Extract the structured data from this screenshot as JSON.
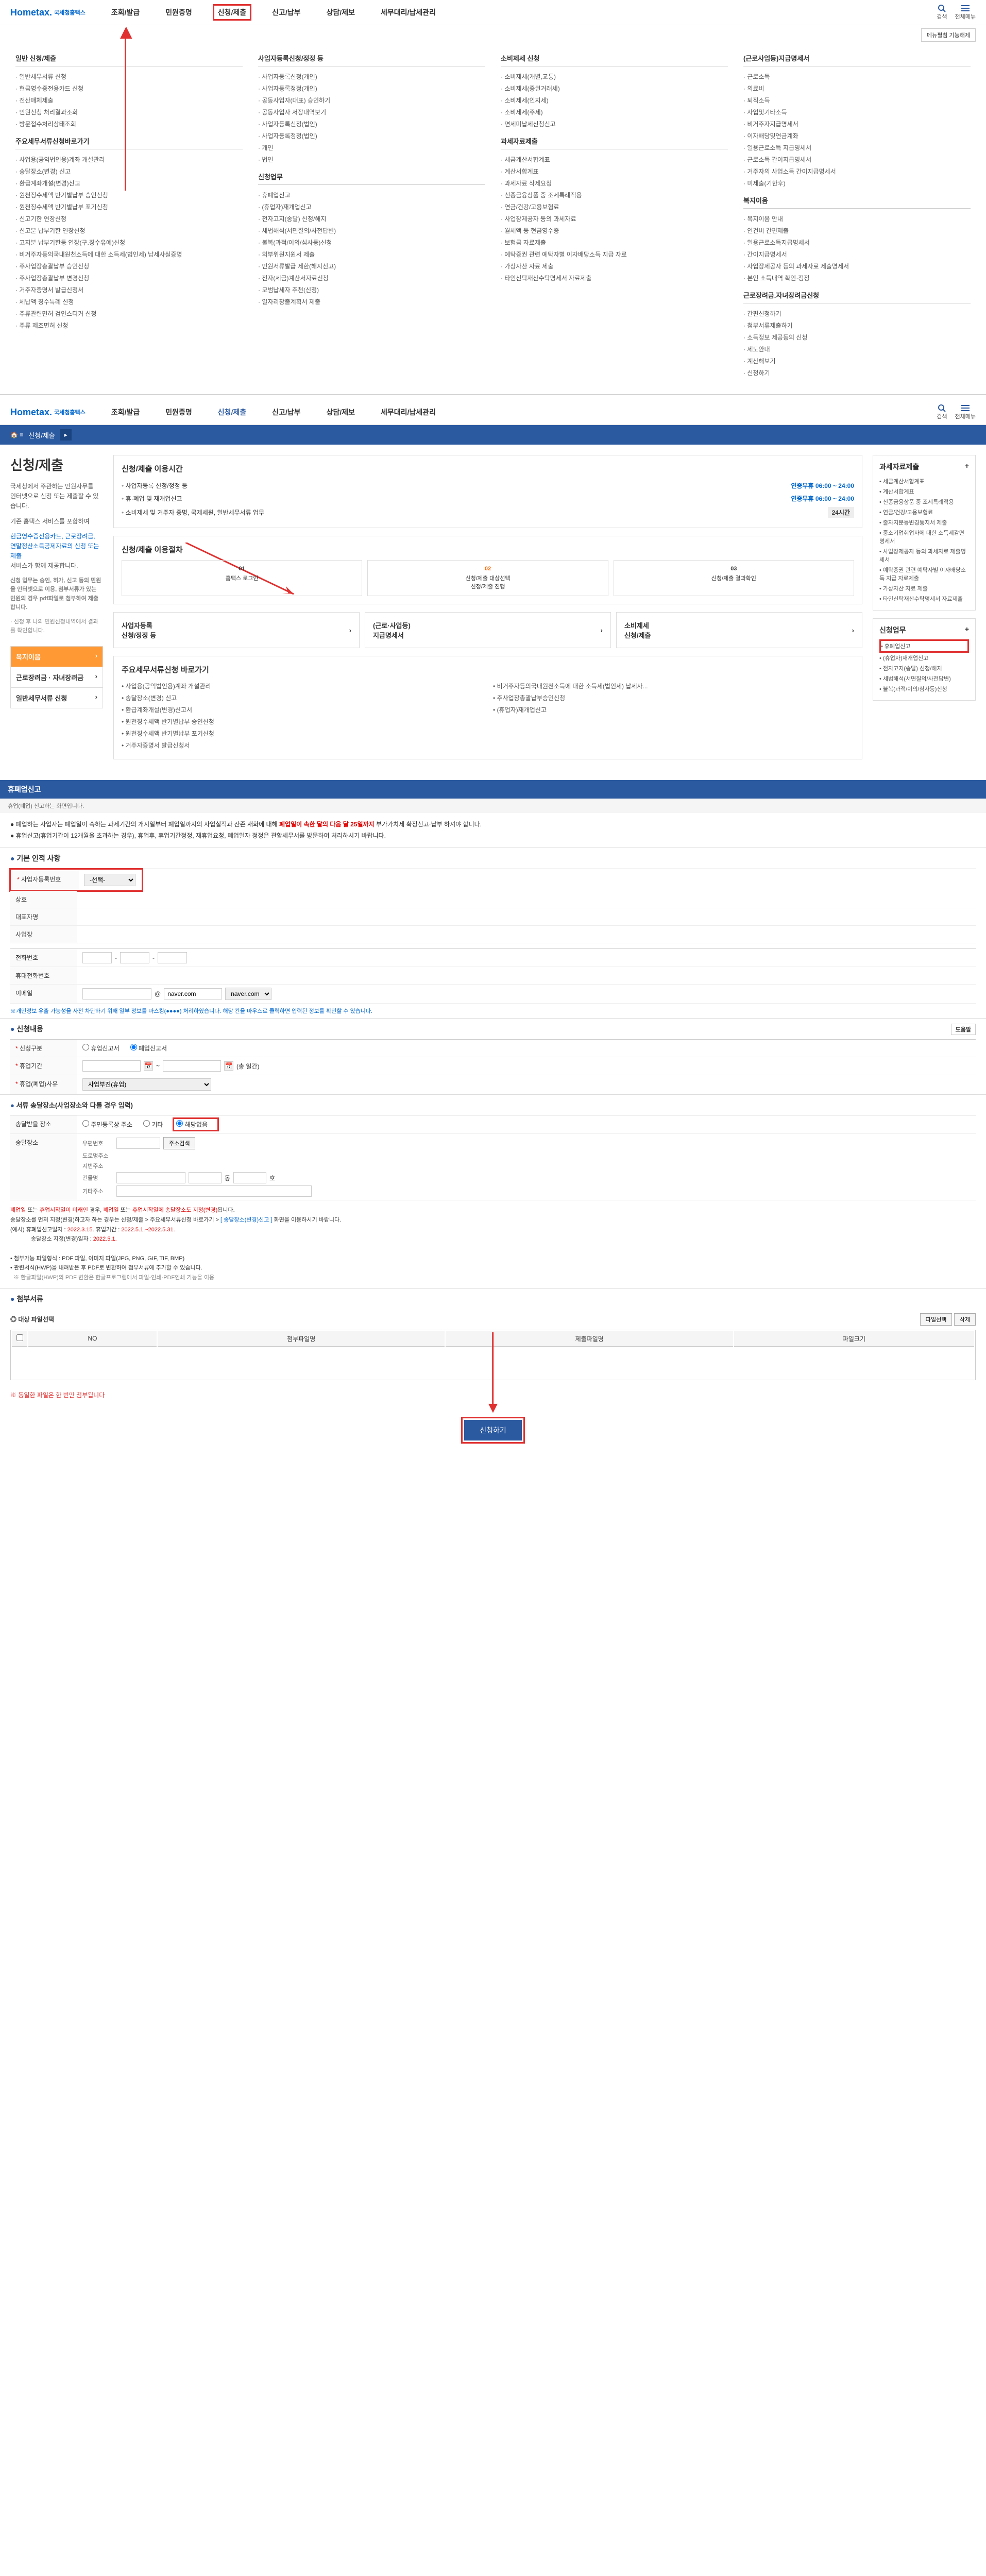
{
  "logo": {
    "main": "Hometax.",
    "sub": "국세청홈택스"
  },
  "nav": [
    "조회/발급",
    "민원증명",
    "신청/제출",
    "신고/납부",
    "상담/제보",
    "세무대리/납세관리"
  ],
  "rightIcons": {
    "search": "검색",
    "all": "전체메뉴"
  },
  "menuFunc": "메뉴펼침 기능해제",
  "mega": {
    "c1t1": "일반 신청/제출",
    "c1l1": [
      "일반세무서류 신청",
      "현금영수증전용카드 신청",
      "전산매체제출",
      "민원신청 처리결과조회",
      "방문접수처리상태조회"
    ],
    "c1t2": "주요세무서류신청바로가기",
    "c1l2": [
      "사업용(공익법인용)계좌 개설관리",
      "송달장소(변경) 신고",
      "환급계좌개설(변경)신고",
      "원천징수세액 반기별납부 승인신청",
      "원천징수세액 반기별납부 포기신청",
      "신고기한 연장신청",
      "신고분 납부기한 연장신청",
      "고지분 납부기한등 연장(구.징수유예)신청",
      "비거주자등의국내원천소득에 대한 소득세(법인세) 납세사실증명",
      "주사업장총괄납부 승인신청",
      "주사업장총괄납부 변경신청",
      "거주자증명서 발급신청서",
      "체납액 징수특례 신청",
      "주류관련면허 검인스티커 신청",
      "주류 제조면허 신청"
    ],
    "c2t1": "사업자등록신청/정정 등",
    "c2l1": [
      "사업자등록신청(개인)",
      "사업자등록정정(개인)",
      "공동사업자(대표) 승인하기",
      "공동사업자 저장내역보기",
      "사업자등록신청(법인)",
      "사업자등록정정(법인)",
      "개인",
      "법인"
    ],
    "c2t2": "신청업무",
    "c2l2": [
      "휴폐업신고",
      "(휴업자)재개업신고",
      "전자고지(송달) 신청/해지",
      "세법해석(서면질의/사전답변)",
      "불복(과적/이의/심사등)신청",
      "외부위원지원서 제출",
      "민원서류발급 제한(해지신고)",
      "전자(세금)계산서자료신청",
      "모범납세자 추천(신청)",
      "일자리창출계획서 제출"
    ],
    "c3t1": "소비제세 신청",
    "c3l1": [
      "소비제세(개별,교통)",
      "소비제세(증권거래세)",
      "소비제세(인지세)",
      "소비제세(주세)",
      "면세미납세신청신고"
    ],
    "c3t2": "과세자료제출",
    "c3l2": [
      "세금계산서합계표",
      "계산서합계표",
      "과세자료 삭제요청",
      "신종금융상품 중 조세특례적용",
      "연금/건강/고용보험료",
      "사업장제공자 등의 과세자료",
      "월세액 등 현금영수증",
      "보험금 자료제출",
      "예탁증권 관련 예탁자별 이자배당소득 지급 자료",
      "가상자산 자료 제출",
      "타인신탁재산수탁명세서 자료제출"
    ],
    "c4t1": "(근로사업등)지급명세서",
    "c4l1": [
      "근로소득",
      "의료비",
      "퇴직소득",
      "사업및기타소득",
      "비거주자지급명세서",
      "이자배당및연금계좌",
      "일용근로소득 지급명세서",
      "근로소득 간이지급명세서",
      "거주자의 사업소득 간이지급명세서",
      "미제출(기한후)"
    ],
    "c4t2": "복지이음",
    "c4l2": [
      "복지이음 안내",
      "인건비 간편제출",
      "일용근로소득지급명세서",
      "간이지급명세서",
      "사업장제공자 등의 과세자료 제출명세서",
      "본인 소득내역 확인·정정"
    ],
    "c4t3": "근로장려금.자녀장려금신청",
    "c4l3": [
      "간편신청하기",
      "첨부서류제출하기",
      "소득정보 제공동의 신청",
      "제도안내",
      "계산해보기",
      "신청하기"
    ]
  },
  "s2": {
    "bc": "신청/제출",
    "title": "신청/제출",
    "desc1": "국세청에서 주관하는 민원사무를\n인터넷으로 신청 또는 제출할 수 있습니다.",
    "desc2": "기존 홈택스 서비스를 포함하여",
    "link": "현금영수증전용카드, 근로장려금,\n연말정산소득공제자료의 신청 또는 제출",
    "desc3": "서비스가 함께 제공합니다.",
    "desc4": "신청 업무는 승인, 허가, 신고 등의 민원을 인터넷으로 이용, 첨부서류가 있는 민원의 경우 pdf파일로 첨부하여 제출합니다.",
    "desc5": "· 신청 후 나의 민원신청내역에서 결과를 확인합니다.",
    "side": [
      "복지이음",
      "근로장려금 · 자녀장려금",
      "일반세무서류 신청"
    ],
    "infoT1": "신청/제출 이용시간",
    "info1a": "사업자등록 신청/정정 등",
    "info1at": "연중무휴 06:00 ~ 24:00",
    "info1b": "휴·폐업 및 재개업신고",
    "info1bt": "연중무휴 06:00 ~ 24:00",
    "info1c": "소비제세 및 거주자 증명, 국제세원, 일반세무서류 업무",
    "info1ct": "24시간",
    "infoT2": "신청/제출 이용절차",
    "steps": [
      {
        "n": "01",
        "t": "홈택스 로그인"
      },
      {
        "n": "02",
        "t": "신청/제출 대상선택\n신청/제출 진행"
      },
      {
        "n": "03",
        "t": "신청/제출 결과확인"
      }
    ],
    "boxes": [
      "사업자등록\n신청/정정 등",
      "(근로·사업등)\n지급명세서",
      "소비제세\n신청/제출"
    ],
    "shortT": "주요세무서류신청 바로가기",
    "shortL1": [
      "사업용(공익법인용)계좌 개설관리",
      "송달장소(변경) 신고",
      "환급계좌개설(변경)신고서",
      "원천징수세액 반기별납부 승인신청",
      "원천징수세액 반기별납부 포기신청",
      "거주자증명서 발급신청서"
    ],
    "shortL2": [
      "비거주자등의국내원천소득에 대한 소득세(법인세) 납세사...",
      "주사업장총괄납부승인신청",
      "(휴업자)재개업신고"
    ],
    "r1T": "과세자료제출",
    "r1L": [
      "세금계산서합계표",
      "계산서합계표",
      "신종금융상품 중 조세특례적용",
      "연금/건강/고용보험료",
      "출자지분등변경통지서 제출",
      "중소기업취업자에 대한 소득세감면명세서",
      "사업장제공자 등의 과세자료 제출명세서",
      "예탁증권 관련 예탁자별 이자배당소득 지급 자료제출",
      "가상자산 자료 제출",
      "타인신탁재산수탁명세서 자료제출"
    ],
    "r2T": "신청업무",
    "r2L": [
      "휴폐업신고",
      "(휴업자)재개업신고",
      "전자고지(송달) 신청/해지",
      "세법해석(서면질의/사전답변)",
      "불복(과적/이의/심사등)신청"
    ]
  },
  "s3": {
    "title": "휴폐업신고",
    "sub": "휴업(폐업) 신고하는 화면입니다.",
    "notice1pre": "폐업하는 사업자는 폐업일이 속하는 과세기간의 개시일부터 폐업일까지의 사업실적과 잔존 재화에 대해 ",
    "notice1hl": "폐업일이 속한 달의 다음 달 25일까지",
    "notice1post": " 부가가치세 확정신고·납부 하셔야 합니다.",
    "notice2": "휴업신고(휴업기간이 12개월을 초과하는 경우), 휴업후, 휴업기간정정, 재휴업요청, 폐업일자 정정은 관할세무서를 방문하여 처리하시기 바랍니다.",
    "sec1": "기본 인적 사항",
    "f_bizno": "사업자등록번호",
    "f_bizno_sel": "-선택-",
    "f_name": "상호",
    "f_rep": "대표자명",
    "f_addr": "사업장",
    "f_tel": "전화번호",
    "f_mobile": "휴대전화번호",
    "f_email": "이메일",
    "f_email_dom": "naver.com",
    "hint1pre": "※개인정보 유출 가능성을 사전 차단하기 위해 일부 정보를 마스킹(●●●●) 처리하였습니다. 해당 칸을 마우스로 클릭하면 입력된 정보를 확인할 수 있습니다.",
    "sec2": "신청내용",
    "help": "도움말",
    "f_type": "신청구분",
    "f_type_o1": "휴업신고서",
    "f_type_o2": "폐업신고서",
    "f_period": "휴업기간",
    "f_period_days": "(총   일간)",
    "f_reason": "휴업(폐업)사유",
    "f_reason_sel": "사업부진(휴업)",
    "sec3": "서류 송달장소(사업장소와 다를 경우 입력)",
    "f_send": "송달받을 장소",
    "f_send_o1": "주민등록상 주소",
    "f_send_o2": "기타",
    "f_send_o3": "해당없음",
    "addr_post": "우편번호",
    "addr_btn": "주소검색",
    "addr_road": "도로명주소",
    "addr_jibun": "지번주소",
    "addr_bldg": "건물명",
    "addr_etc": "기타주소",
    "f_sendloc": "송달장소",
    "warn1_a": "폐업일",
    "warn1_b": " 또는 ",
    "warn1_c": "휴업시작일이 미래인 ",
    "warn1_d": "경우, ",
    "warn1_e": "폐업일",
    "warn1_f": " 또는 ",
    "warn1_g": "휴업시작일에 송달장소도 지정(변경)",
    "warn1_h": "됩니다.",
    "warn2_a": "송달장소를 먼저 지정(변경)하고자 하는 경우는 신청/제출 > 주요세무서류신청 바로가기 > ",
    "warn2_b": "[ 송달장소(변경)신고 ]",
    "warn2_c": " 화면을 이용하시기 바랍니다.",
    "warn3_a": "(예시) 휴폐업신고일자 : ",
    "warn3_b": "2022.3.15.",
    "warn3_c": "   휴업기간 : ",
    "warn3_d": "2022.5.1.~2022.5.31.",
    "warn4_a": "송달장소 지정(변경)일자 : ",
    "warn4_b": "2022.5.1.",
    "warn5": "첨부가능 파일형식 : PDF 파일, 이미지 파일(JPG, PNG, GIF, TIF, BMP)",
    "warn6": "관련서식(HWP)을 내려받은 후 PDF로 변환하여 첨부서류에 추가할 수 있습니다.",
    "warn7": "※ 한글파일(HWP)의 PDF 변환은 한글프로그램에서 파일-인쇄-PDF인쇄 기능을 이용",
    "sec4": "첨부서류",
    "sec5": "대상 파일선택",
    "btn_sel": "파일선택",
    "btn_del": "삭제",
    "th1": "NO",
    "th2": "첨부파일명",
    "th3": "제출파일명",
    "th4": "파일크기",
    "footnote": "동일한 파일은 한 번만 첨부됩니다",
    "submit": "신청하기"
  }
}
